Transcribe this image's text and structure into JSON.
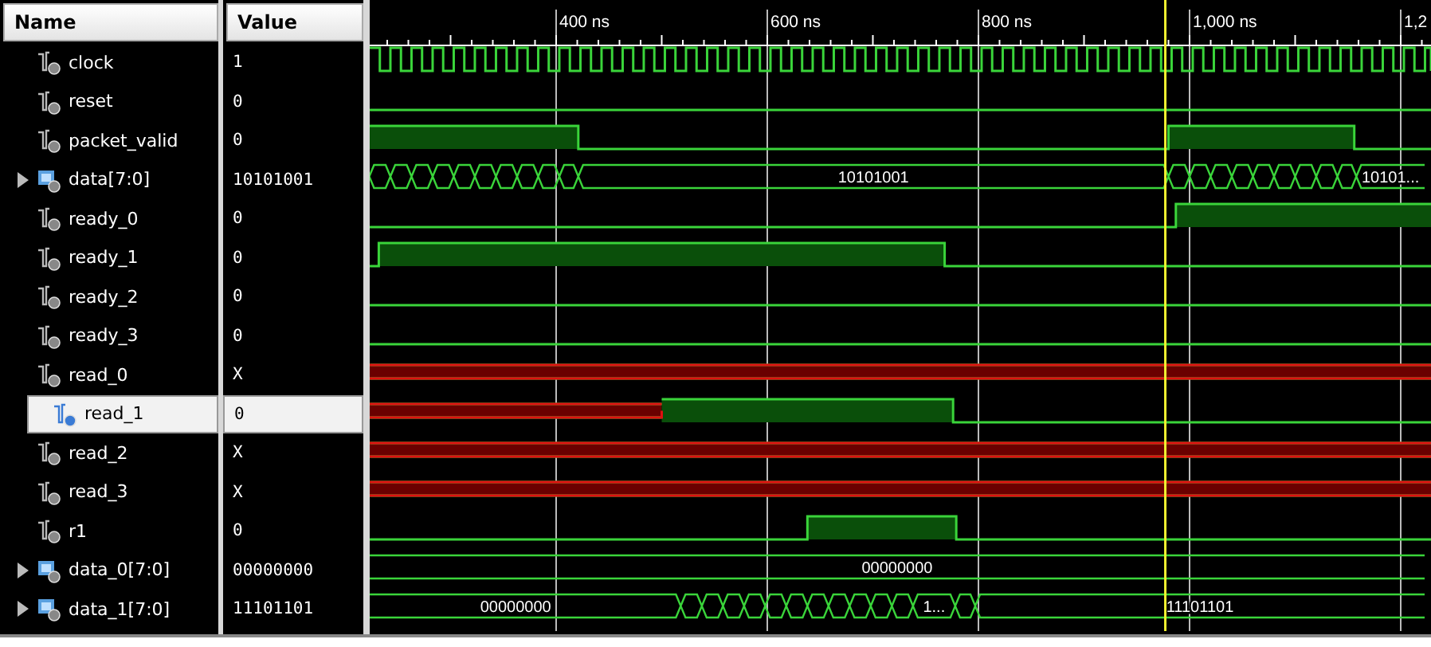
{
  "columns": {
    "name": "Name",
    "value": "Value"
  },
  "ruler_labels": [
    "400 ns",
    "600 ns",
    "800 ns",
    "1,000 ns",
    "1,2"
  ],
  "signals": [
    {
      "name": "clock",
      "value": "1",
      "kind": "bit",
      "selected": false
    },
    {
      "name": "reset",
      "value": "0",
      "kind": "bit",
      "selected": false
    },
    {
      "name": "packet_valid",
      "value": "0",
      "kind": "bit",
      "selected": false
    },
    {
      "name": "data[7:0]",
      "value": "10101001",
      "kind": "bus",
      "selected": false,
      "wave_labels": [
        "10101001",
        "10101..."
      ]
    },
    {
      "name": "ready_0",
      "value": "0",
      "kind": "bit",
      "selected": false
    },
    {
      "name": "ready_1",
      "value": "0",
      "kind": "bit",
      "selected": false
    },
    {
      "name": "ready_2",
      "value": "0",
      "kind": "bit",
      "selected": false
    },
    {
      "name": "ready_3",
      "value": "0",
      "kind": "bit",
      "selected": false
    },
    {
      "name": "read_0",
      "value": "X",
      "kind": "bit",
      "selected": false
    },
    {
      "name": "read_1",
      "value": "0",
      "kind": "bit",
      "selected": true
    },
    {
      "name": "read_2",
      "value": "X",
      "kind": "bit",
      "selected": false
    },
    {
      "name": "read_3",
      "value": "X",
      "kind": "bit",
      "selected": false
    },
    {
      "name": "r1",
      "value": "0",
      "kind": "bit",
      "selected": false
    },
    {
      "name": "data_0[7:0]",
      "value": "00000000",
      "kind": "bus",
      "selected": false,
      "wave_labels": [
        "00000000"
      ]
    },
    {
      "name": "data_1[7:0]",
      "value": "11101101",
      "kind": "bus",
      "selected": false,
      "wave_labels": [
        "00000000",
        "1...",
        "11101101"
      ]
    }
  ]
}
